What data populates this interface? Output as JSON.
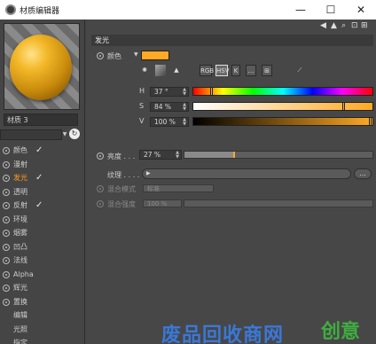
{
  "window": {
    "title": "材质编辑器",
    "minimize": "—",
    "maximize": "☐",
    "close": "✕"
  },
  "material": {
    "name": "材质 3"
  },
  "channels": [
    {
      "label": "颜色",
      "checked": true,
      "active": false,
      "radio": true
    },
    {
      "label": "漫射",
      "checked": false,
      "active": false,
      "radio": true
    },
    {
      "label": "发光",
      "checked": true,
      "active": true,
      "radio": true
    },
    {
      "label": "透明",
      "checked": false,
      "active": false,
      "radio": true
    },
    {
      "label": "反射",
      "checked": true,
      "active": false,
      "radio": true
    },
    {
      "label": "环境",
      "checked": false,
      "active": false,
      "radio": true
    },
    {
      "label": "烟雾",
      "checked": false,
      "active": false,
      "radio": true
    },
    {
      "label": "凹凸",
      "checked": false,
      "active": false,
      "radio": true
    },
    {
      "label": "法线",
      "checked": false,
      "active": false,
      "radio": true
    },
    {
      "label": "Alpha",
      "checked": false,
      "active": false,
      "radio": true
    },
    {
      "label": "辉光",
      "checked": false,
      "active": false,
      "radio": true
    },
    {
      "label": "置换",
      "checked": false,
      "active": false,
      "radio": true
    },
    {
      "label": "编辑",
      "checked": false,
      "active": false,
      "radio": false
    },
    {
      "label": "光照",
      "checked": false,
      "active": false,
      "radio": false
    },
    {
      "label": "指定",
      "checked": false,
      "active": false,
      "radio": false
    }
  ],
  "panel": {
    "section_title": "发光",
    "color_label": "颜色",
    "color_value": "#ffa925",
    "mode_icons": [
      "RGB",
      "HSV",
      "K",
      "…",
      "⊞"
    ],
    "h_label": "H",
    "h_value": "37 °",
    "h_fraction": 0.103,
    "s_label": "S",
    "s_value": "84 %",
    "s_fraction": 0.84,
    "v_label": "V",
    "v_value": "100 %",
    "v_fraction": 1.0,
    "brightness_label": "亮度 . . .",
    "brightness_value": "27 %",
    "brightness_fraction": 0.27,
    "texture_label": "纹理 . . . .",
    "texture_button": "...",
    "mix_mode_label": "混合模式",
    "mix_mode_value": "标准",
    "mix_strength_label": "混合强度",
    "mix_strength_value": "100 %"
  },
  "watermark": {
    "text": "废品回收商网",
    "text2": "创意"
  }
}
